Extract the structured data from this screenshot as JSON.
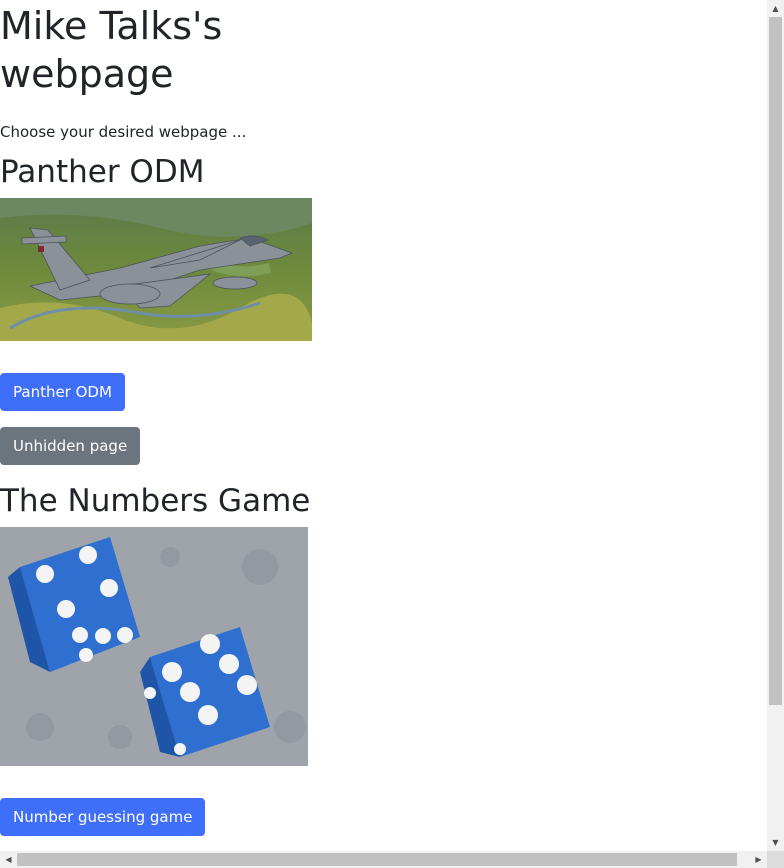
{
  "page": {
    "title": "Mike Talks's webpage",
    "intro": "Choose your desired webpage ..."
  },
  "sections": [
    {
      "heading": "Panther ODM",
      "image": "jet-aircraft-photo",
      "buttons": [
        {
          "label": "Panther ODM",
          "style": "primary"
        },
        {
          "label": "Unhidden page",
          "style": "secondary"
        }
      ]
    },
    {
      "heading": "The Numbers Game",
      "image": "blue-dice-photo",
      "buttons": [
        {
          "label": "Number guessing game",
          "style": "primary"
        }
      ]
    }
  ],
  "colors": {
    "primary": "#3f6ef8",
    "secondary": "#6c757d",
    "text": "#212529"
  },
  "scrollbars": {
    "vertical_arrow_up": "▲",
    "vertical_arrow_down": "▼",
    "horizontal_arrow_left": "◀",
    "horizontal_arrow_right": "▶"
  }
}
